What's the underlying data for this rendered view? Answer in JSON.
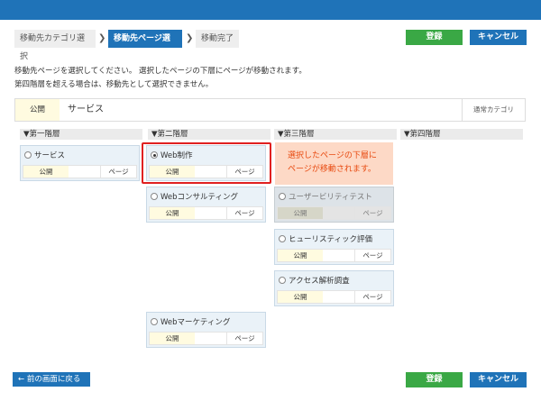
{
  "breadcrumb": {
    "step1": "移動先カテゴリ選択",
    "step2": "移動先ページ選択",
    "step3": "移動完了",
    "separator": "❯"
  },
  "actions": {
    "register": "登録",
    "cancel": "キャンセル",
    "back": "前の画面に戻る"
  },
  "message": {
    "line1": "移動先ページを選択してください。 選択したページの下層にページが移動されます。",
    "line2": "第四階層を超える場合は、移動先として選択できません。"
  },
  "category": {
    "status": "公開",
    "name": "サービス",
    "type": "通常カテゴリ"
  },
  "columns": [
    "▼第一階層",
    "▼第二階層",
    "▼第三階層",
    "▼第四階層"
  ],
  "card_labels": {
    "status": "公開",
    "page": "ページ"
  },
  "cards": {
    "level1": [
      {
        "title": "サービス",
        "selected": false
      }
    ],
    "level2": [
      {
        "title": "Web制作",
        "selected": true
      },
      {
        "title": "Webコンサルティング",
        "selected": false
      },
      {
        "title": "Webマーケティング",
        "selected": false
      }
    ],
    "level3": [
      {
        "title": "ユーザービリティテスト",
        "selected": false,
        "disabled": true
      },
      {
        "title": "ヒューリスティック評価",
        "selected": false
      },
      {
        "title": "アクセス解析調査",
        "selected": false
      }
    ]
  },
  "note": {
    "line1": "選択したページの下層に",
    "line2": "ページが移動されます。"
  },
  "colors": {
    "primary": "#1f73b8",
    "success": "#3aa845",
    "highlight": "#e02020",
    "note_text": "#e84a10",
    "note_bg": "#fdd9c6"
  }
}
